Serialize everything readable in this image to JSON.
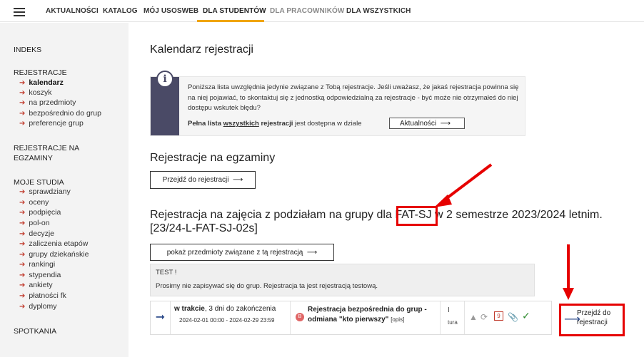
{
  "topnav": {
    "items": [
      "AKTUALNOŚCI",
      "KATALOG",
      "MÓJ USOSWEB",
      "DLA STUDENTÓW",
      "DLA PRACOWNIKÓW",
      "DLA WSZYSTKICH"
    ],
    "active": "DLA STUDENTÓW",
    "accent_color": "#f0a500"
  },
  "sidebar": {
    "sections": {
      "indeks": "INDEKS",
      "rejestracje": "REJESTRACJE",
      "rej_egz_1": "REJESTRACJE NA",
      "rej_egz_2": "EGZAMINY",
      "moje_studia": "MOJE STUDIA",
      "spotkania": "SPOTKANIA"
    },
    "rejestracje_items": [
      "kalendarz",
      "koszyk",
      "na przedmioty",
      "bezpośrednio do grup",
      "preferencje grup"
    ],
    "moje_studia_items": [
      "sprawdziany",
      "oceny",
      "podpięcia",
      "pol-on",
      "decyzje",
      "zaliczenia etapów",
      "grupy dziekańskie",
      "rankingi",
      "stypendia",
      "ankiety",
      "płatności fk",
      "dyplomy"
    ]
  },
  "main": {
    "title": "Kalendarz rejestracji",
    "info": {
      "icon": "info-icon",
      "text": "Poniższa lista uwzględnia jedynie związane z Tobą rejestracje. Jeśli uważasz, że jakaś rejestracja powinna się na niej pojawiać, to skontaktuj się z jednostką odpowiedzialną za rejestracje - być może nie otrzymałeś do niej dostępu wskutek błędu?",
      "full_list_prefix": "Pełna lista",
      "full_list_link": "wszystkich",
      "full_list_mid": "rejestracji",
      "full_list_suffix": "jest dostępna w dziale",
      "aktualnosci_button": "Aktualności"
    },
    "exams_heading": "Rejestracje na egzaminy",
    "exams_button": "Przejdź do rejestracji",
    "groups_heading_1a": "Rejestracja na zajęcia z podziałam na grupy dla",
    "groups_heading_code": "FAT-SJ",
    "groups_heading_1b": "w 2 semestrze 2023/2024 letnim.",
    "groups_heading_2": "[23/24-L-FAT-SJ-02s]",
    "show_subjects_button": "pokaż przedmioty związane z tą rejestracją",
    "test_line_1": "TEST !",
    "test_line_2": "Prosimy nie zapisywać się do grup. Rejestracja ta jest rejestracją testową.",
    "registration_row": {
      "status_bold": "w trakcie",
      "status_rest": ", 3 dni do zakończenia",
      "dates": "2024-02-01 00:00 - 2024-02-29 23:59",
      "dot_label": "B",
      "name_1": "Rejestracja bezpośrednia do grup -",
      "name_2": "odmiana \"kto pierwszy\"",
      "opis": "[opis]",
      "tura_1": "I",
      "tura_2": "tura",
      "count": "9",
      "goto_1": "Przejdź do",
      "goto_2": "rejestracji"
    }
  },
  "annotation_color": "#e60000"
}
